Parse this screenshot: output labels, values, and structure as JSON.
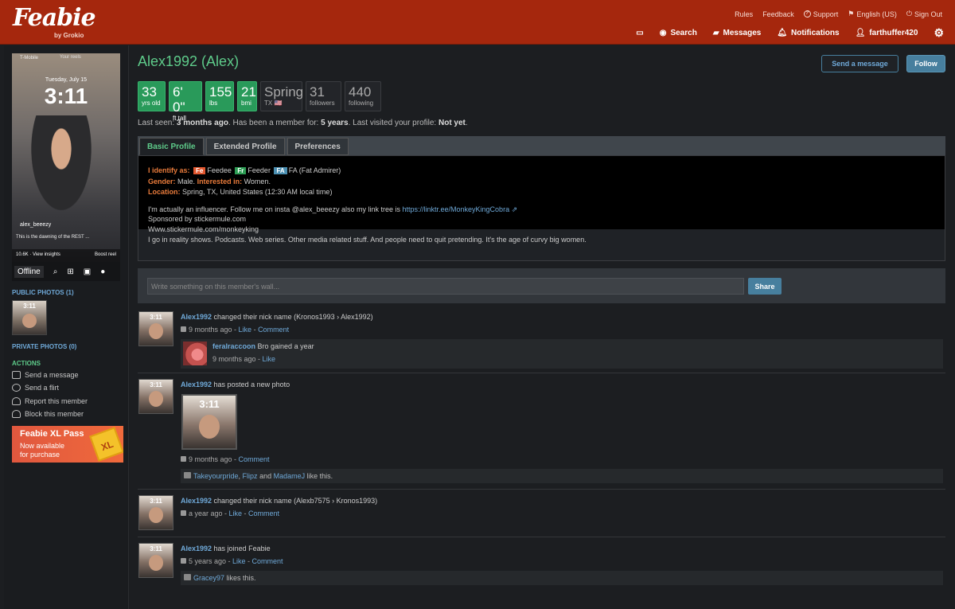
{
  "header": {
    "logo": "Feabie",
    "logo_by": "by Grokio",
    "top_links": [
      "Rules",
      "Feedback",
      "Support",
      "English (US)",
      "Sign Out"
    ],
    "nav": {
      "search": "Search",
      "messages": "Messages",
      "notifications": "Notifications",
      "user": "farthuffer420"
    }
  },
  "sidebar": {
    "photo": {
      "t1": "T-Mobile",
      "t2": "Your reels",
      "date": "Tuesday, July 15",
      "time": "3:11",
      "uname": "alex_beeezy",
      "cap": "This is the dawning of the REST ...",
      "views": "10.6K · View insights",
      "boost": "Boost reel"
    },
    "offline": "Offline",
    "public_photos": "PUBLIC PHOTOS (1)",
    "private_photos": "PRIVATE PHOTOS (0)",
    "actions_label": "ACTIONS",
    "actions": [
      "Send a message",
      "Send a flirt",
      "Report this member",
      "Block this member"
    ],
    "thumb_time": "3:11",
    "ad": {
      "title": "Feabie XL Pass",
      "line1": "Now available",
      "line2": "for purchase",
      "badge": "XL"
    }
  },
  "profile": {
    "title": "Alex1992 (Alex)",
    "send_message": "Send a message",
    "follow": "Follow",
    "stats": [
      {
        "v": "33",
        "l": "yrs old"
      },
      {
        "v": "6' 0\"",
        "l": "ft tall"
      },
      {
        "v": "155",
        "l": "lbs"
      },
      {
        "v": "21",
        "l": "bmi"
      },
      {
        "v": "Spring",
        "l": "TX 🇺🇸"
      },
      {
        "v": "31",
        "l": "followers"
      },
      {
        "v": "440",
        "l": "following"
      }
    ],
    "lastseen": {
      "a": "Last seen: ",
      "b": "3 months ago",
      "c": ". Has been a member for: ",
      "d": "5 years",
      "e": ". Last visited your profile: ",
      "f": "Not yet",
      "g": "."
    },
    "tabs": [
      "Basic Profile",
      "Extended Profile",
      "Preferences"
    ],
    "identify_label": "I identify as:",
    "badges": [
      {
        "k": "Fe",
        "t": "Feedee",
        "c": "#e2572f"
      },
      {
        "k": "Fr",
        "t": "Feeder",
        "c": "#2e9e55"
      },
      {
        "k": "FA",
        "t": "FA (Fat Admirer)",
        "c": "#4b8fb1"
      }
    ],
    "gender_label": "Gender:",
    "gender": "Male.",
    "interested_label": "Interested in:",
    "interested": "Women.",
    "location_label": "Location:",
    "location": "Spring, TX, United States (12:30 AM local time)",
    "bio1": "I'm actually an influencer. Follow me on insta @alex_beeezy also my link tree is ",
    "bio1_link": "https://linktr.ee/MonkeyKingCobra",
    "bio2": "Sponsored by stickermule.com",
    "bio3": "Www.stickermule.com/monkeyking",
    "bio4": "I go in reality shows. Podcasts. Web series. Other media related stuff. And people need to quit pretending. It's the age of curvy big women."
  },
  "wall": {
    "placeholder": "Write something on this member's wall...",
    "share": "Share"
  },
  "feed": [
    {
      "user": "Alex1992",
      "text": " changed their nick name (Kronos1993 › Alex1992)",
      "time": "9 months ago",
      "like": "Like",
      "comment": "Comment",
      "reply": {
        "user": "feralraccoon",
        "text": " Bro gained a year",
        "time": "9 months ago",
        "like": "Like"
      }
    },
    {
      "user": "Alex1992",
      "text": " has posted a new photo",
      "time": "9 months ago",
      "comment": "Comment",
      "photo_time": "3:11",
      "likes": {
        "a": "Takeyourpride",
        "b": "Flipz",
        "and": " and ",
        "c": "MadameJ",
        "tail": " like this.",
        "sep": ", "
      }
    },
    {
      "user": "Alex1992",
      "text": " changed their nick name (Alexb7575 › Kronos1993)",
      "time": "a year ago",
      "like": "Like",
      "comment": "Comment"
    },
    {
      "user": "Alex1992",
      "text": " has joined Feabie",
      "time": "5 years ago",
      "like": "Like",
      "comment": "Comment",
      "likes": {
        "a": "Gracey97",
        "tail": " likes this."
      }
    }
  ],
  "common": {
    "dash": " - ",
    "thumb_time": "3:11"
  }
}
